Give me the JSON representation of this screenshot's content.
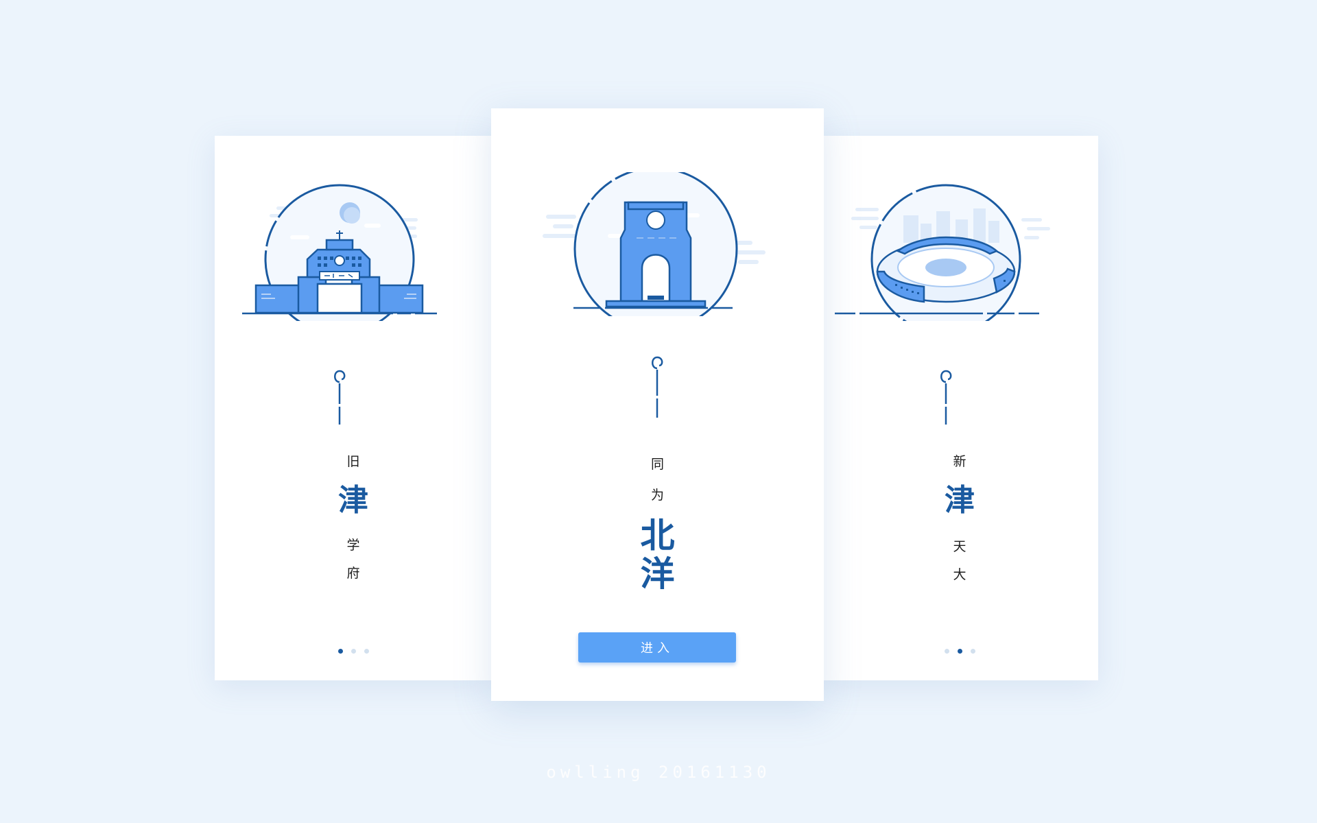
{
  "cards": {
    "left": {
      "top_char": "旧",
      "big_char": "津",
      "bottom_chars": [
        "学",
        "府"
      ],
      "pager_active_index": 0
    },
    "center": {
      "top_chars": [
        "同",
        "为"
      ],
      "big_chars": [
        "北",
        "洋"
      ],
      "enter_button": "进入"
    },
    "right": {
      "top_char": "新",
      "big_char": "津",
      "bottom_chars": [
        "天",
        "大"
      ],
      "pager_active_index": 1
    }
  },
  "pager": {
    "total": 3
  },
  "footer": {
    "signature": "owlling 20161130"
  },
  "colors": {
    "background": "#ecf4fc",
    "primary_dark": "#1a5aa0",
    "building_blue": "#5b9cf0",
    "button_blue": "#5aa2f6",
    "dot_inactive": "#d2e0ee"
  },
  "icons": [
    "old-gate-building-icon",
    "memorial-arch-icon",
    "ring-building-icon",
    "ornament-hook-icon"
  ]
}
